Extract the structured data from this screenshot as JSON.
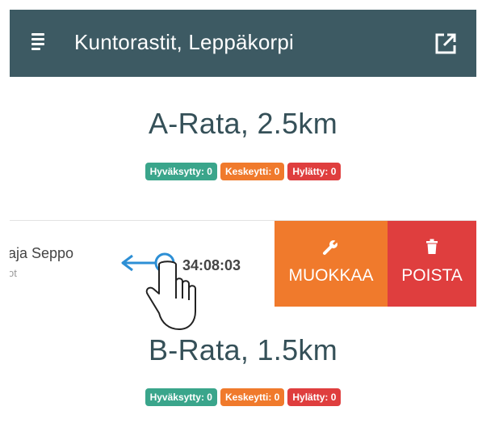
{
  "appbar": {
    "title": "Kuntorastit, Leppäkorpi",
    "menu_icon": "menu-icon",
    "open_icon": "open-in-new-icon",
    "color": "#3d5a63"
  },
  "courses": [
    {
      "title": "A-Rata, 2.5km",
      "accepted": "Hyväksytty: 0",
      "interrupted": "Keskeytti: 0",
      "rejected": "Hylätty: 0"
    },
    {
      "title": "B-Rata, 1.5km",
      "accepted": "Hyväksytty: 0",
      "interrupted": "Keskeytti: 0",
      "rejected": "Hylätty: 0"
    }
  ],
  "result_row": {
    "name": "aja Seppo",
    "sub": "ot",
    "time": "34:08:03",
    "edit_label": "MUOKKAA",
    "delete_label": "POISTA"
  },
  "colors": {
    "accepted": "#3aa58b",
    "interrupted": "#f07a2c",
    "rejected": "#df3e3e",
    "title_text": "#355058"
  }
}
